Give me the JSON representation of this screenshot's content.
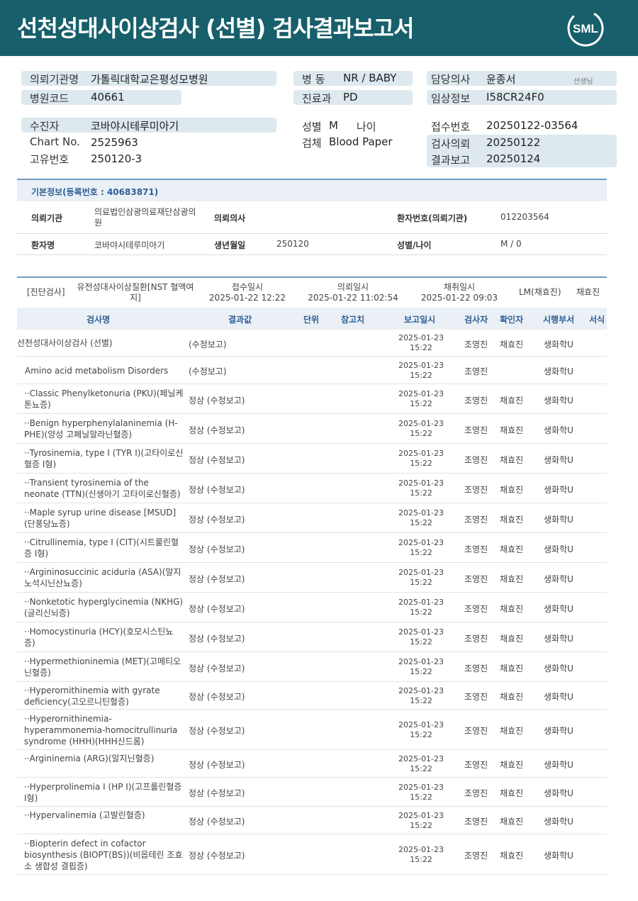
{
  "header": {
    "title": "선천성대사이상검사 (선별) 검사결과보고서",
    "logo_text": "SML",
    "bg_color": "#175f6a"
  },
  "info": {
    "institution_label": "의뢰기관명",
    "institution": "가톨릭대학교은평성모병원",
    "ward_label": "병 동",
    "ward": "NR / BABY",
    "doctor_label": "담당의사",
    "doctor": "윤종서",
    "doctor_title": "선생님",
    "hospital_code_label": "병원코드",
    "hospital_code": "40661",
    "dept_label": "진료과",
    "dept": "PD",
    "clinical_label": "임상정보",
    "clinical": "I58CR24F0",
    "patient_label": "수진자",
    "patient": "코바야시테루미아기",
    "sex_label": "성별",
    "sex": "M",
    "age_label": "나이",
    "age": "",
    "receipt_label": "접수번호",
    "receipt": "20250122-03564",
    "chart_label": "Chart No.",
    "chart": "2525963",
    "specimen_label": "검체",
    "specimen": "Blood Paper",
    "request_label": "검사의뢰",
    "request": "20250122",
    "unique_label": "고유번호",
    "unique": "250120-3",
    "report_label": "결과보고",
    "report": "20250124"
  },
  "basic": {
    "title": "기본정보(등록번호 : 40683871)",
    "inst_label": "의뢰기관",
    "inst": "의료법인삼광의료재단삼광의원",
    "req_doc_label": "의뢰의사",
    "req_doc": "",
    "pt_no_label": "환자번호(의뢰기관)",
    "pt_no": "012203564",
    "pt_name_label": "환자명",
    "pt_name": "코바야시테루미아기",
    "birth_label": "생년월일",
    "birth": "250120",
    "sexage_label": "성별/나이",
    "sexage": "M / 0"
  },
  "diag": {
    "category": "[진단검사]",
    "test_name": "유전성대사이상질환[NST 혈액여지]",
    "recv_label": "접수일시",
    "recv": "2025-01-22 12:22",
    "req_label": "의뢰일시",
    "req": "2025-01-22 11:02:54",
    "coll_label": "채취일시",
    "coll": "2025-01-22 09:03",
    "lm": "LM(채효진)",
    "person": "채효진"
  },
  "columns": {
    "name": "검사명",
    "result": "결과값",
    "unit": "단위",
    "ref": "참고치",
    "date": "보고일시",
    "tester": "검사자",
    "confirmer": "확인자",
    "dept": "시행부서",
    "format": "서식"
  },
  "rows": [
    {
      "name": "선천성대사이상검사 (선별)",
      "result": "(수정보고)",
      "date": "2025-01-23 15:22",
      "tester": "조영진",
      "confirmer": "채효진",
      "dept": "생화학U"
    },
    {
      "name": "Amino acid metabolism Disorders",
      "result": "(수정보고)",
      "date": "2025-01-23 15:22",
      "tester": "조영진",
      "confirmer": "",
      "dept": "생화학U"
    },
    {
      "name": "··Classic Phenylketonuria (PKU)(페닐케톤뇨증)",
      "result": "정상 (수정보고)",
      "date": "2025-01-23 15:22",
      "tester": "조영진",
      "confirmer": "채효진",
      "dept": "생화학U"
    },
    {
      "name": "··Benign hyperphenylalaninemia (H-PHE)(양성 고페닐알라닌혈증)",
      "result": "정상 (수정보고)",
      "date": "2025-01-23 15:22",
      "tester": "조영진",
      "confirmer": "채효진",
      "dept": "생화학U"
    },
    {
      "name": "··Tyrosinemia, type I (TYR I)(고타이로신혈증 I형)",
      "result": "정상 (수정보고)",
      "date": "2025-01-23 15:22",
      "tester": "조영진",
      "confirmer": "채효진",
      "dept": "생화학U"
    },
    {
      "name": "··Transient tyrosinemia of the neonate (TTN)(신생아기 고타이로신혈증)",
      "result": "정상 (수정보고)",
      "date": "2025-01-23 15:22",
      "tester": "조영진",
      "confirmer": "채효진",
      "dept": "생화학U"
    },
    {
      "name": "··Maple syrup urine disease [MSUD](단풍당뇨증)",
      "result": "정상 (수정보고)",
      "date": "2025-01-23 15:22",
      "tester": "조영진",
      "confirmer": "채효진",
      "dept": "생화학U"
    },
    {
      "name": "··Citrullinemia, type I (CIT)(시트룰린혈증 I형)",
      "result": "정상 (수정보고)",
      "date": "2025-01-23 15:22",
      "tester": "조영진",
      "confirmer": "채효진",
      "dept": "생화학U"
    },
    {
      "name": "··Argininosuccinic aciduria (ASA)(알지노석시닌산뇨증)",
      "result": "정상 (수정보고)",
      "date": "2025-01-23 15:22",
      "tester": "조영진",
      "confirmer": "채효진",
      "dept": "생화학U"
    },
    {
      "name": "··Nonketotic hyperglycinemia (NKHG)(글리신뇌증)",
      "result": "정상 (수정보고)",
      "date": "2025-01-23 15:22",
      "tester": "조영진",
      "confirmer": "채효진",
      "dept": "생화학U"
    },
    {
      "name": "··Homocystinuria (HCY)(호모시스틴뇨증)",
      "result": "정상 (수정보고)",
      "date": "2025-01-23 15:22",
      "tester": "조영진",
      "confirmer": "채효진",
      "dept": "생화학U"
    },
    {
      "name": "··Hypermethioninemia (MET)(고메티오닌혈증)",
      "result": "정상 (수정보고)",
      "date": "2025-01-23 15:22",
      "tester": "조영진",
      "confirmer": "채효진",
      "dept": "생화학U"
    },
    {
      "name": "··Hyperornithinemia with gyrate deficiency(고오르니틴혈증)",
      "result": "정상 (수정보고)",
      "date": "2025-01-23 15:22",
      "tester": "조영진",
      "confirmer": "채효진",
      "dept": "생화학U"
    },
    {
      "name": "··Hyperornithinemia-hyperammonemia-homocitrullinuria syndrome (HHH)(HHH신드롬)",
      "result": "정상 (수정보고)",
      "date": "2025-01-23 15:22",
      "tester": "조영진",
      "confirmer": "채효진",
      "dept": "생화학U"
    },
    {
      "name": "··Argininemia (ARG)(알지닌혈증)",
      "result": "정상 (수정보고)",
      "date": "2025-01-23 15:22",
      "tester": "조영진",
      "confirmer": "채효진",
      "dept": "생화학U"
    },
    {
      "name": "··Hyperprolinemia I (HP I)(고프롤린혈증 I형)",
      "result": "정상 (수정보고)",
      "date": "2025-01-23 15:22",
      "tester": "조영진",
      "confirmer": "채효진",
      "dept": "생화학U"
    },
    {
      "name": "··Hypervalinemia (고발린혈증)",
      "result": "정상 (수정보고)",
      "date": "2025-01-23 15:22",
      "tester": "조영진",
      "confirmer": "채효진",
      "dept": "생화학U"
    },
    {
      "name": "··Biopterin defect in cofactor biosynthesis (BIOPT(BS))(비옵테린 조효소 생합성 결핍증)",
      "result": "정상 (수정보고)",
      "date": "2025-01-23 15:22",
      "tester": "조영진",
      "confirmer": "채효진",
      "dept": "생화학U"
    }
  ]
}
